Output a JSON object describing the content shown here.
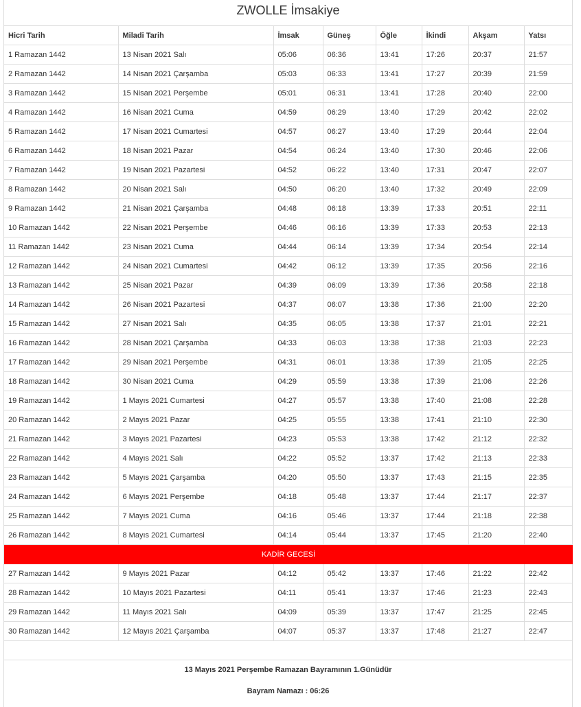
{
  "page": {
    "title": "ZWOLLE İmsakiye"
  },
  "table": {
    "headers": [
      "Hicri Tarih",
      "Miladi Tarih",
      "İmsak",
      "Güneş",
      "Öğle",
      "İkindi",
      "Akşam",
      "Yatsı"
    ],
    "rows_before": [
      [
        "1 Ramazan 1442",
        "13 Nisan 2021 Salı",
        "05:06",
        "06:36",
        "13:41",
        "17:26",
        "20:37",
        "21:57"
      ],
      [
        "2 Ramazan 1442",
        "14 Nisan 2021 Çarşamba",
        "05:03",
        "06:33",
        "13:41",
        "17:27",
        "20:39",
        "21:59"
      ],
      [
        "3 Ramazan 1442",
        "15 Nisan 2021 Perşembe",
        "05:01",
        "06:31",
        "13:41",
        "17:28",
        "20:40",
        "22:00"
      ],
      [
        "4 Ramazan 1442",
        "16 Nisan 2021 Cuma",
        "04:59",
        "06:29",
        "13:40",
        "17:29",
        "20:42",
        "22:02"
      ],
      [
        "5 Ramazan 1442",
        "17 Nisan 2021 Cumartesi",
        "04:57",
        "06:27",
        "13:40",
        "17:29",
        "20:44",
        "22:04"
      ],
      [
        "6 Ramazan 1442",
        "18 Nisan 2021 Pazar",
        "04:54",
        "06:24",
        "13:40",
        "17:30",
        "20:46",
        "22:06"
      ],
      [
        "7 Ramazan 1442",
        "19 Nisan 2021 Pazartesi",
        "04:52",
        "06:22",
        "13:40",
        "17:31",
        "20:47",
        "22:07"
      ],
      [
        "8 Ramazan 1442",
        "20 Nisan 2021 Salı",
        "04:50",
        "06:20",
        "13:40",
        "17:32",
        "20:49",
        "22:09"
      ],
      [
        "9 Ramazan 1442",
        "21 Nisan 2021 Çarşamba",
        "04:48",
        "06:18",
        "13:39",
        "17:33",
        "20:51",
        "22:11"
      ],
      [
        "10 Ramazan 1442",
        "22 Nisan 2021 Perşembe",
        "04:46",
        "06:16",
        "13:39",
        "17:33",
        "20:53",
        "22:13"
      ],
      [
        "11 Ramazan 1442",
        "23 Nisan 2021 Cuma",
        "04:44",
        "06:14",
        "13:39",
        "17:34",
        "20:54",
        "22:14"
      ],
      [
        "12 Ramazan 1442",
        "24 Nisan 2021 Cumartesi",
        "04:42",
        "06:12",
        "13:39",
        "17:35",
        "20:56",
        "22:16"
      ],
      [
        "13 Ramazan 1442",
        "25 Nisan 2021 Pazar",
        "04:39",
        "06:09",
        "13:39",
        "17:36",
        "20:58",
        "22:18"
      ],
      [
        "14 Ramazan 1442",
        "26 Nisan 2021 Pazartesi",
        "04:37",
        "06:07",
        "13:38",
        "17:36",
        "21:00",
        "22:20"
      ],
      [
        "15 Ramazan 1442",
        "27 Nisan 2021 Salı",
        "04:35",
        "06:05",
        "13:38",
        "17:37",
        "21:01",
        "22:21"
      ],
      [
        "16 Ramazan 1442",
        "28 Nisan 2021 Çarşamba",
        "04:33",
        "06:03",
        "13:38",
        "17:38",
        "21:03",
        "22:23"
      ],
      [
        "17 Ramazan 1442",
        "29 Nisan 2021 Perşembe",
        "04:31",
        "06:01",
        "13:38",
        "17:39",
        "21:05",
        "22:25"
      ],
      [
        "18 Ramazan 1442",
        "30 Nisan 2021 Cuma",
        "04:29",
        "05:59",
        "13:38",
        "17:39",
        "21:06",
        "22:26"
      ],
      [
        "19 Ramazan 1442",
        "1 Mayıs 2021 Cumartesi",
        "04:27",
        "05:57",
        "13:38",
        "17:40",
        "21:08",
        "22:28"
      ],
      [
        "20 Ramazan 1442",
        "2 Mayıs 2021 Pazar",
        "04:25",
        "05:55",
        "13:38",
        "17:41",
        "21:10",
        "22:30"
      ],
      [
        "21 Ramazan 1442",
        "3 Mayıs 2021 Pazartesi",
        "04:23",
        "05:53",
        "13:38",
        "17:42",
        "21:12",
        "22:32"
      ],
      [
        "22 Ramazan 1442",
        "4 Mayıs 2021 Salı",
        "04:22",
        "05:52",
        "13:37",
        "17:42",
        "21:13",
        "22:33"
      ],
      [
        "23 Ramazan 1442",
        "5 Mayıs 2021 Çarşamba",
        "04:20",
        "05:50",
        "13:37",
        "17:43",
        "21:15",
        "22:35"
      ],
      [
        "24 Ramazan 1442",
        "6 Mayıs 2021 Perşembe",
        "04:18",
        "05:48",
        "13:37",
        "17:44",
        "21:17",
        "22:37"
      ],
      [
        "25 Ramazan 1442",
        "7 Mayıs 2021 Cuma",
        "04:16",
        "05:46",
        "13:37",
        "17:44",
        "21:18",
        "22:38"
      ],
      [
        "26 Ramazan 1442",
        "8 Mayıs 2021 Cumartesi",
        "04:14",
        "05:44",
        "13:37",
        "17:45",
        "21:20",
        "22:40"
      ]
    ],
    "kadir_label": "KADİR GECESİ",
    "rows_after": [
      [
        "27 Ramazan 1442",
        "9 Mayıs 2021 Pazar",
        "04:12",
        "05:42",
        "13:37",
        "17:46",
        "21:22",
        "22:42"
      ],
      [
        "28 Ramazan 1442",
        "10 Mayıs 2021 Pazartesi",
        "04:11",
        "05:41",
        "13:37",
        "17:46",
        "21:23",
        "22:43"
      ],
      [
        "29 Ramazan 1442",
        "11 Mayıs 2021 Salı",
        "04:09",
        "05:39",
        "13:37",
        "17:47",
        "21:25",
        "22:45"
      ],
      [
        "30 Ramazan 1442",
        "12 Mayıs 2021 Çarşamba",
        "04:07",
        "05:37",
        "13:37",
        "17:48",
        "21:27",
        "22:47"
      ]
    ]
  },
  "footer": {
    "bayram_text": "13 Mayıs 2021 Perşembe Ramazan Bayramının 1.Günüdür",
    "namaz_text": "Bayram Namazı : 06:26"
  },
  "colors": {
    "highlight": "#ff0000",
    "border": "#dddddd",
    "text": "#333333"
  }
}
